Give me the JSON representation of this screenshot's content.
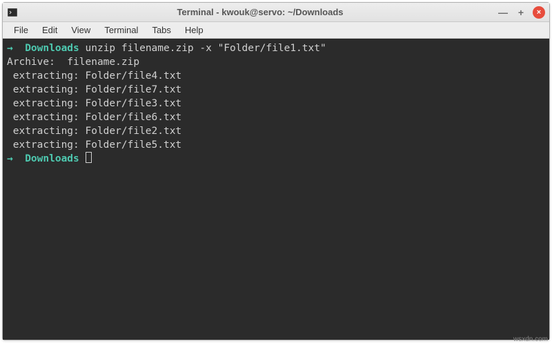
{
  "titlebar": {
    "app_icon_name": "terminal-icon",
    "title": "Terminal - kwouk@servo: ~/Downloads"
  },
  "window_controls": {
    "minimize_glyph": "—",
    "maximize_glyph": "+",
    "close_glyph": "×"
  },
  "menubar": {
    "items": [
      "File",
      "Edit",
      "View",
      "Terminal",
      "Tabs",
      "Help"
    ]
  },
  "terminal": {
    "prompt_arrow": "→",
    "prompt_dir": "Downloads",
    "command": "unzip filename.zip -x \"Folder/file1.txt\"",
    "output_lines": [
      "Archive:  filename.zip",
      " extracting: Folder/file4.txt",
      " extracting: Folder/file7.txt",
      " extracting: Folder/file3.txt",
      " extracting: Folder/file6.txt",
      " extracting: Folder/file2.txt",
      " extracting: Folder/file5.txt"
    ]
  },
  "watermark": "wsxdn.com"
}
